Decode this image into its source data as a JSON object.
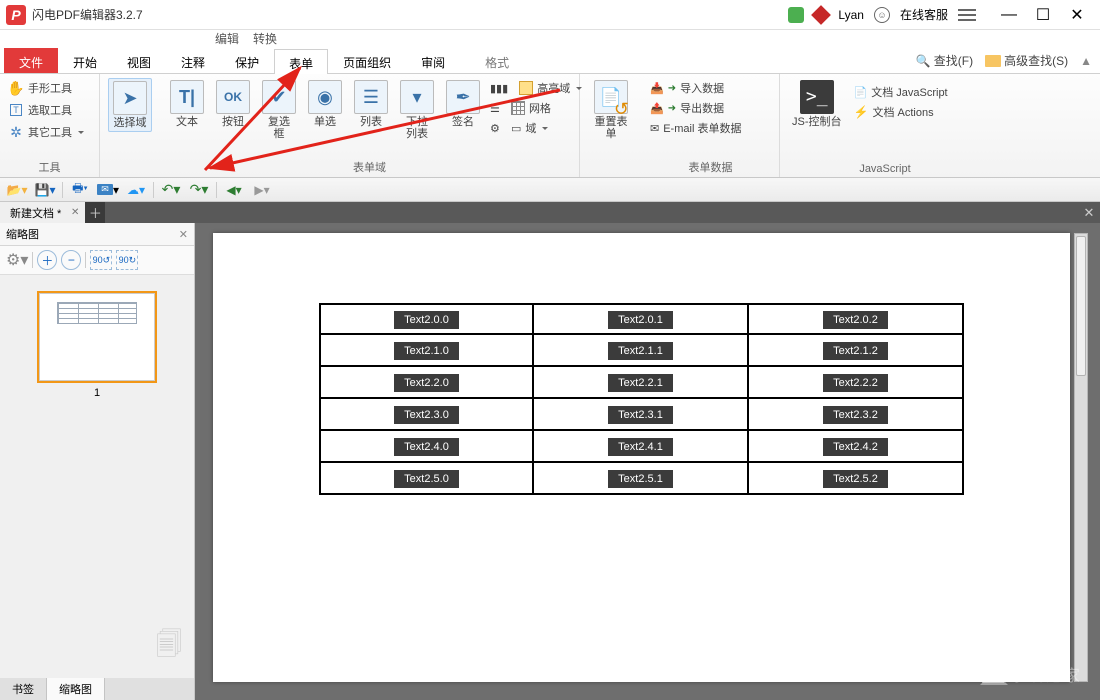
{
  "app": {
    "title": "闪电PDF编辑器3.2.7",
    "user": "Lyan",
    "online_service": "在线客服"
  },
  "submenu": {
    "edit": "编辑",
    "convert": "转换"
  },
  "tabs": {
    "file": "文件",
    "start": "开始",
    "view": "视图",
    "annotate": "注释",
    "protect": "保护",
    "form": "表单",
    "page_org": "页面组织",
    "review": "审阅",
    "format": "格式",
    "find": "查找(F)",
    "adv_find": "高级查找(S)"
  },
  "ribbon": {
    "tools_group": "工具",
    "hand_tool": "手形工具",
    "select_tool": "选取工具",
    "other_tool": "其它工具",
    "select_field": "选择域",
    "form_group": "表单域",
    "text": "文本",
    "button": "按钮",
    "checkbox": "复选框",
    "radio": "单选",
    "list": "列表",
    "dropdown": "下拉列表",
    "sign": "签名",
    "highlight_field": "高亮域",
    "grid": "网格",
    "field": "域",
    "reset_form": "重置表单",
    "form_data_group": "表单数据",
    "import_data": "导入数据",
    "export_data": "导出数据",
    "email_form": "E-mail 表单数据",
    "js_group": "JavaScript",
    "js_console": "JS-控制台",
    "doc_js": "文档 JavaScript",
    "doc_actions": "文档 Actions"
  },
  "doc": {
    "tab": "新建文档 *"
  },
  "thumb": {
    "title": "缩略图",
    "page": "1",
    "bookmarks": "书签",
    "thumbnails": "缩略图"
  },
  "table": {
    "rows": [
      [
        "Text2.0.0",
        "Text2.0.1",
        "Text2.0.2"
      ],
      [
        "Text2.1.0",
        "Text2.1.1",
        "Text2.1.2"
      ],
      [
        "Text2.2.0",
        "Text2.2.1",
        "Text2.2.2"
      ],
      [
        "Text2.3.0",
        "Text2.3.1",
        "Text2.3.2"
      ],
      [
        "Text2.4.0",
        "Text2.4.1",
        "Text2.4.2"
      ],
      [
        "Text2.5.0",
        "Text2.5.1",
        "Text2.5.2"
      ]
    ]
  },
  "watermark": "系统之家"
}
